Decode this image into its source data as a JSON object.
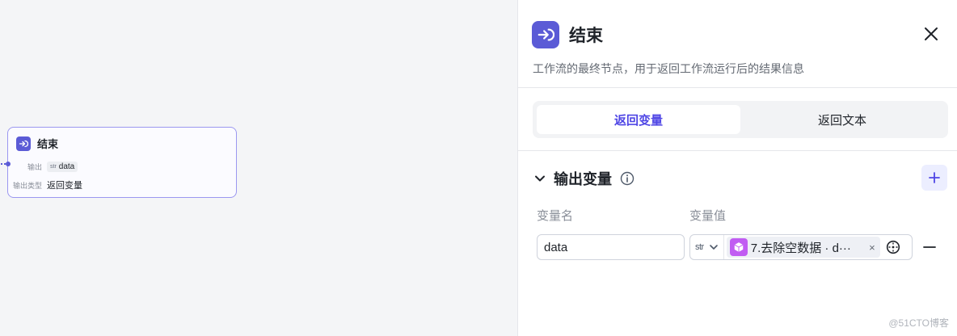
{
  "node": {
    "title": "结束",
    "output_label": "输出",
    "output_type": "str",
    "output_value": "data",
    "output_kind_label": "输出类型",
    "output_kind_value": "返回变量"
  },
  "panel": {
    "title": "结束",
    "description": "工作流的最终节点，用于返回工作流运行后的结果信息",
    "tabs": [
      {
        "label": "返回变量",
        "active": true
      },
      {
        "label": "返回文本",
        "active": false
      }
    ],
    "section_title": "输出变量",
    "columns": {
      "name": "变量名",
      "value": "变量值"
    },
    "variable": {
      "name": "data",
      "type": "str",
      "reference": "7.去除空数据 · d···"
    }
  },
  "colors": {
    "accent": "#5b5bd6",
    "tab_active": "#4f46e5",
    "ref_icon": "#c15cf2"
  },
  "watermark": "@51CTO博客"
}
